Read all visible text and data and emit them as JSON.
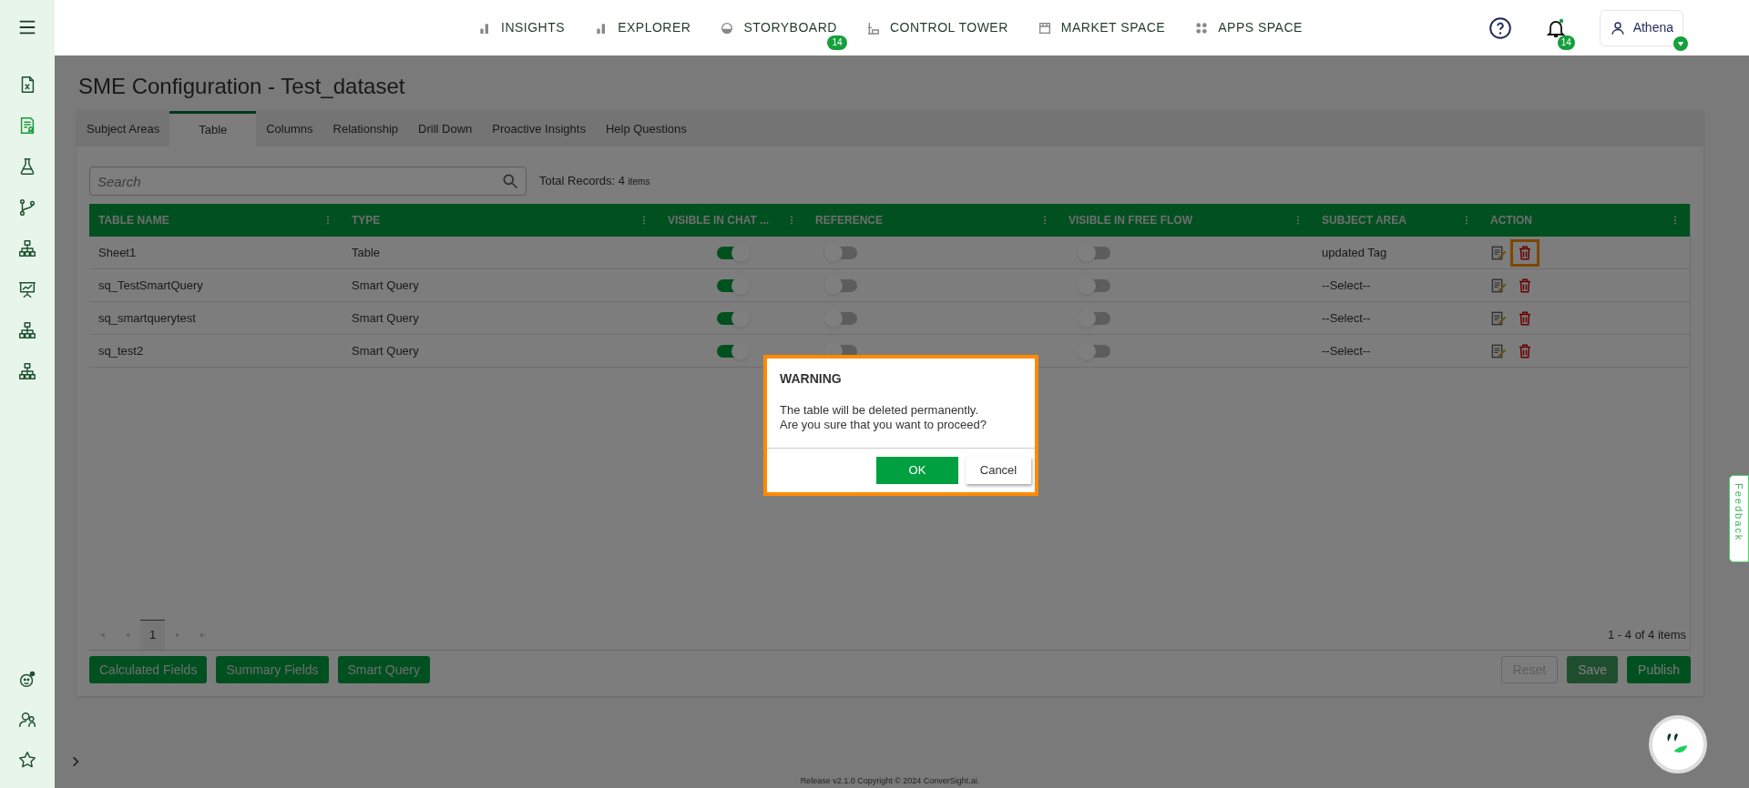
{
  "nav": [
    {
      "label": "INSIGHTS"
    },
    {
      "label": "EXPLORER"
    },
    {
      "label": "STORYBOARD",
      "badge": "14"
    },
    {
      "label": "CONTROL TOWER"
    },
    {
      "label": "MARKET SPACE"
    },
    {
      "label": "APPS SPACE"
    }
  ],
  "notifications": {
    "badge": "14"
  },
  "user": {
    "name": "Athena"
  },
  "page_title": "SME Configuration - Test_dataset",
  "tabs": [
    {
      "label": "Subject Areas",
      "selected": false
    },
    {
      "label": "Table",
      "selected": true
    },
    {
      "label": "Columns",
      "selected": false
    },
    {
      "label": "Relationship",
      "selected": false
    },
    {
      "label": "Drill Down",
      "selected": false
    },
    {
      "label": "Proactive Insights",
      "selected": false
    },
    {
      "label": "Help Questions",
      "selected": false
    }
  ],
  "search": {
    "placeholder": "Search"
  },
  "total_records": {
    "label": "Total Records:",
    "count": "4",
    "unit": "items"
  },
  "table": {
    "columns": [
      "TABLE NAME",
      "TYPE",
      "VISIBLE IN CHAT ...",
      "REFERENCE",
      "VISIBLE IN FREE FLOW",
      "SUBJECT AREA",
      "ACTION"
    ],
    "rows": [
      {
        "name": "Sheet1",
        "type": "Table",
        "visible_in_chat": true,
        "reference": false,
        "visible_in_free_flow": false,
        "subject_area": "updated Tag",
        "delete_highlighted": true
      },
      {
        "name": "sq_TestSmartQuery",
        "type": "Smart Query",
        "visible_in_chat": true,
        "reference": false,
        "visible_in_free_flow": false,
        "subject_area": "--Select--",
        "delete_highlighted": false
      },
      {
        "name": "sq_smartquerytest",
        "type": "Smart Query",
        "visible_in_chat": true,
        "reference": false,
        "visible_in_free_flow": false,
        "subject_area": "--Select--",
        "delete_highlighted": false
      },
      {
        "name": "sq_test2",
        "type": "Smart Query",
        "visible_in_chat": true,
        "reference": false,
        "visible_in_free_flow": false,
        "subject_area": "--Select--",
        "delete_highlighted": false
      }
    ]
  },
  "pager": {
    "page": "1",
    "summary": "1 - 4 of 4 items"
  },
  "left_buttons": [
    "Calculated Fields",
    "Summary Fields",
    "Smart Query"
  ],
  "right_buttons": [
    {
      "label": "Reset",
      "kind": "outline",
      "disabled": true
    },
    {
      "label": "Save",
      "kind": "filled",
      "disabled": true
    },
    {
      "label": "Publish",
      "kind": "filled",
      "disabled": false
    }
  ],
  "footer": "Release v2.1.0 Copyright © 2024 ConverSight.ai.",
  "feedback": "Feedback",
  "dialog": {
    "title": "WARNING",
    "message": [
      "The table will be deleted permanently.",
      "Are you sure that you want to proceed?"
    ],
    "ok": "OK",
    "cancel": "Cancel"
  }
}
